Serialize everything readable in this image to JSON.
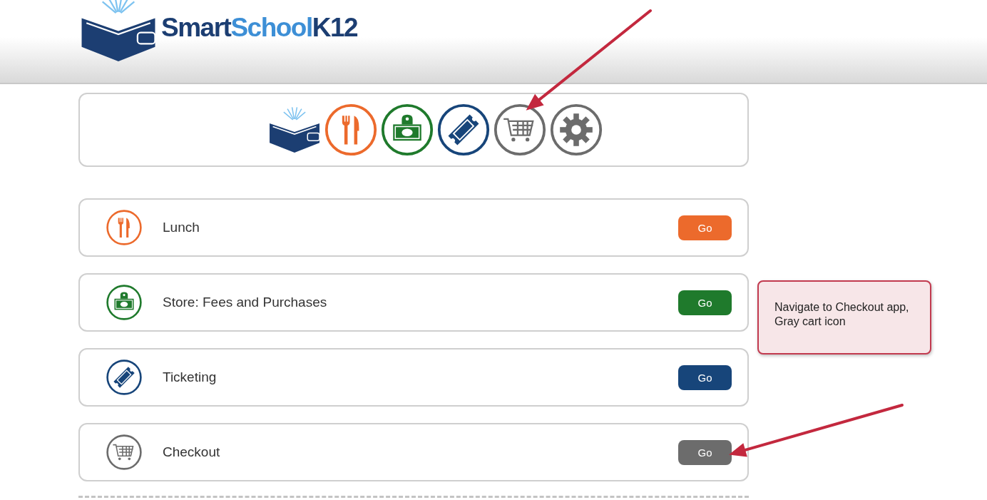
{
  "header": {
    "logo_parts": [
      {
        "text": "Smart",
        "color": "#1c3e72"
      },
      {
        "text": "School",
        "color": "#3d8fd6"
      },
      {
        "text": "K12",
        "color": "#1c3e72"
      }
    ]
  },
  "app_bar": {
    "icons": [
      {
        "kind": "wallet"
      },
      {
        "kind": "lunch"
      },
      {
        "kind": "store"
      },
      {
        "kind": "ticket"
      },
      {
        "kind": "cart"
      },
      {
        "kind": "settings"
      }
    ]
  },
  "apps": [
    {
      "kind": "lunch",
      "label": "Lunch",
      "button": "Go",
      "color": "#ec6a2c"
    },
    {
      "kind": "store",
      "label": "Store: Fees and Purchases",
      "button": "Go",
      "color": "#1f7a2c"
    },
    {
      "kind": "ticket",
      "label": "Ticketing",
      "button": "Go",
      "color": "#17457a"
    },
    {
      "kind": "cart",
      "label": "Checkout",
      "button": "Go",
      "color": "#6c6c6c"
    }
  ],
  "annotations": {
    "note": "Navigate to Checkout app, Gray cart icon"
  }
}
